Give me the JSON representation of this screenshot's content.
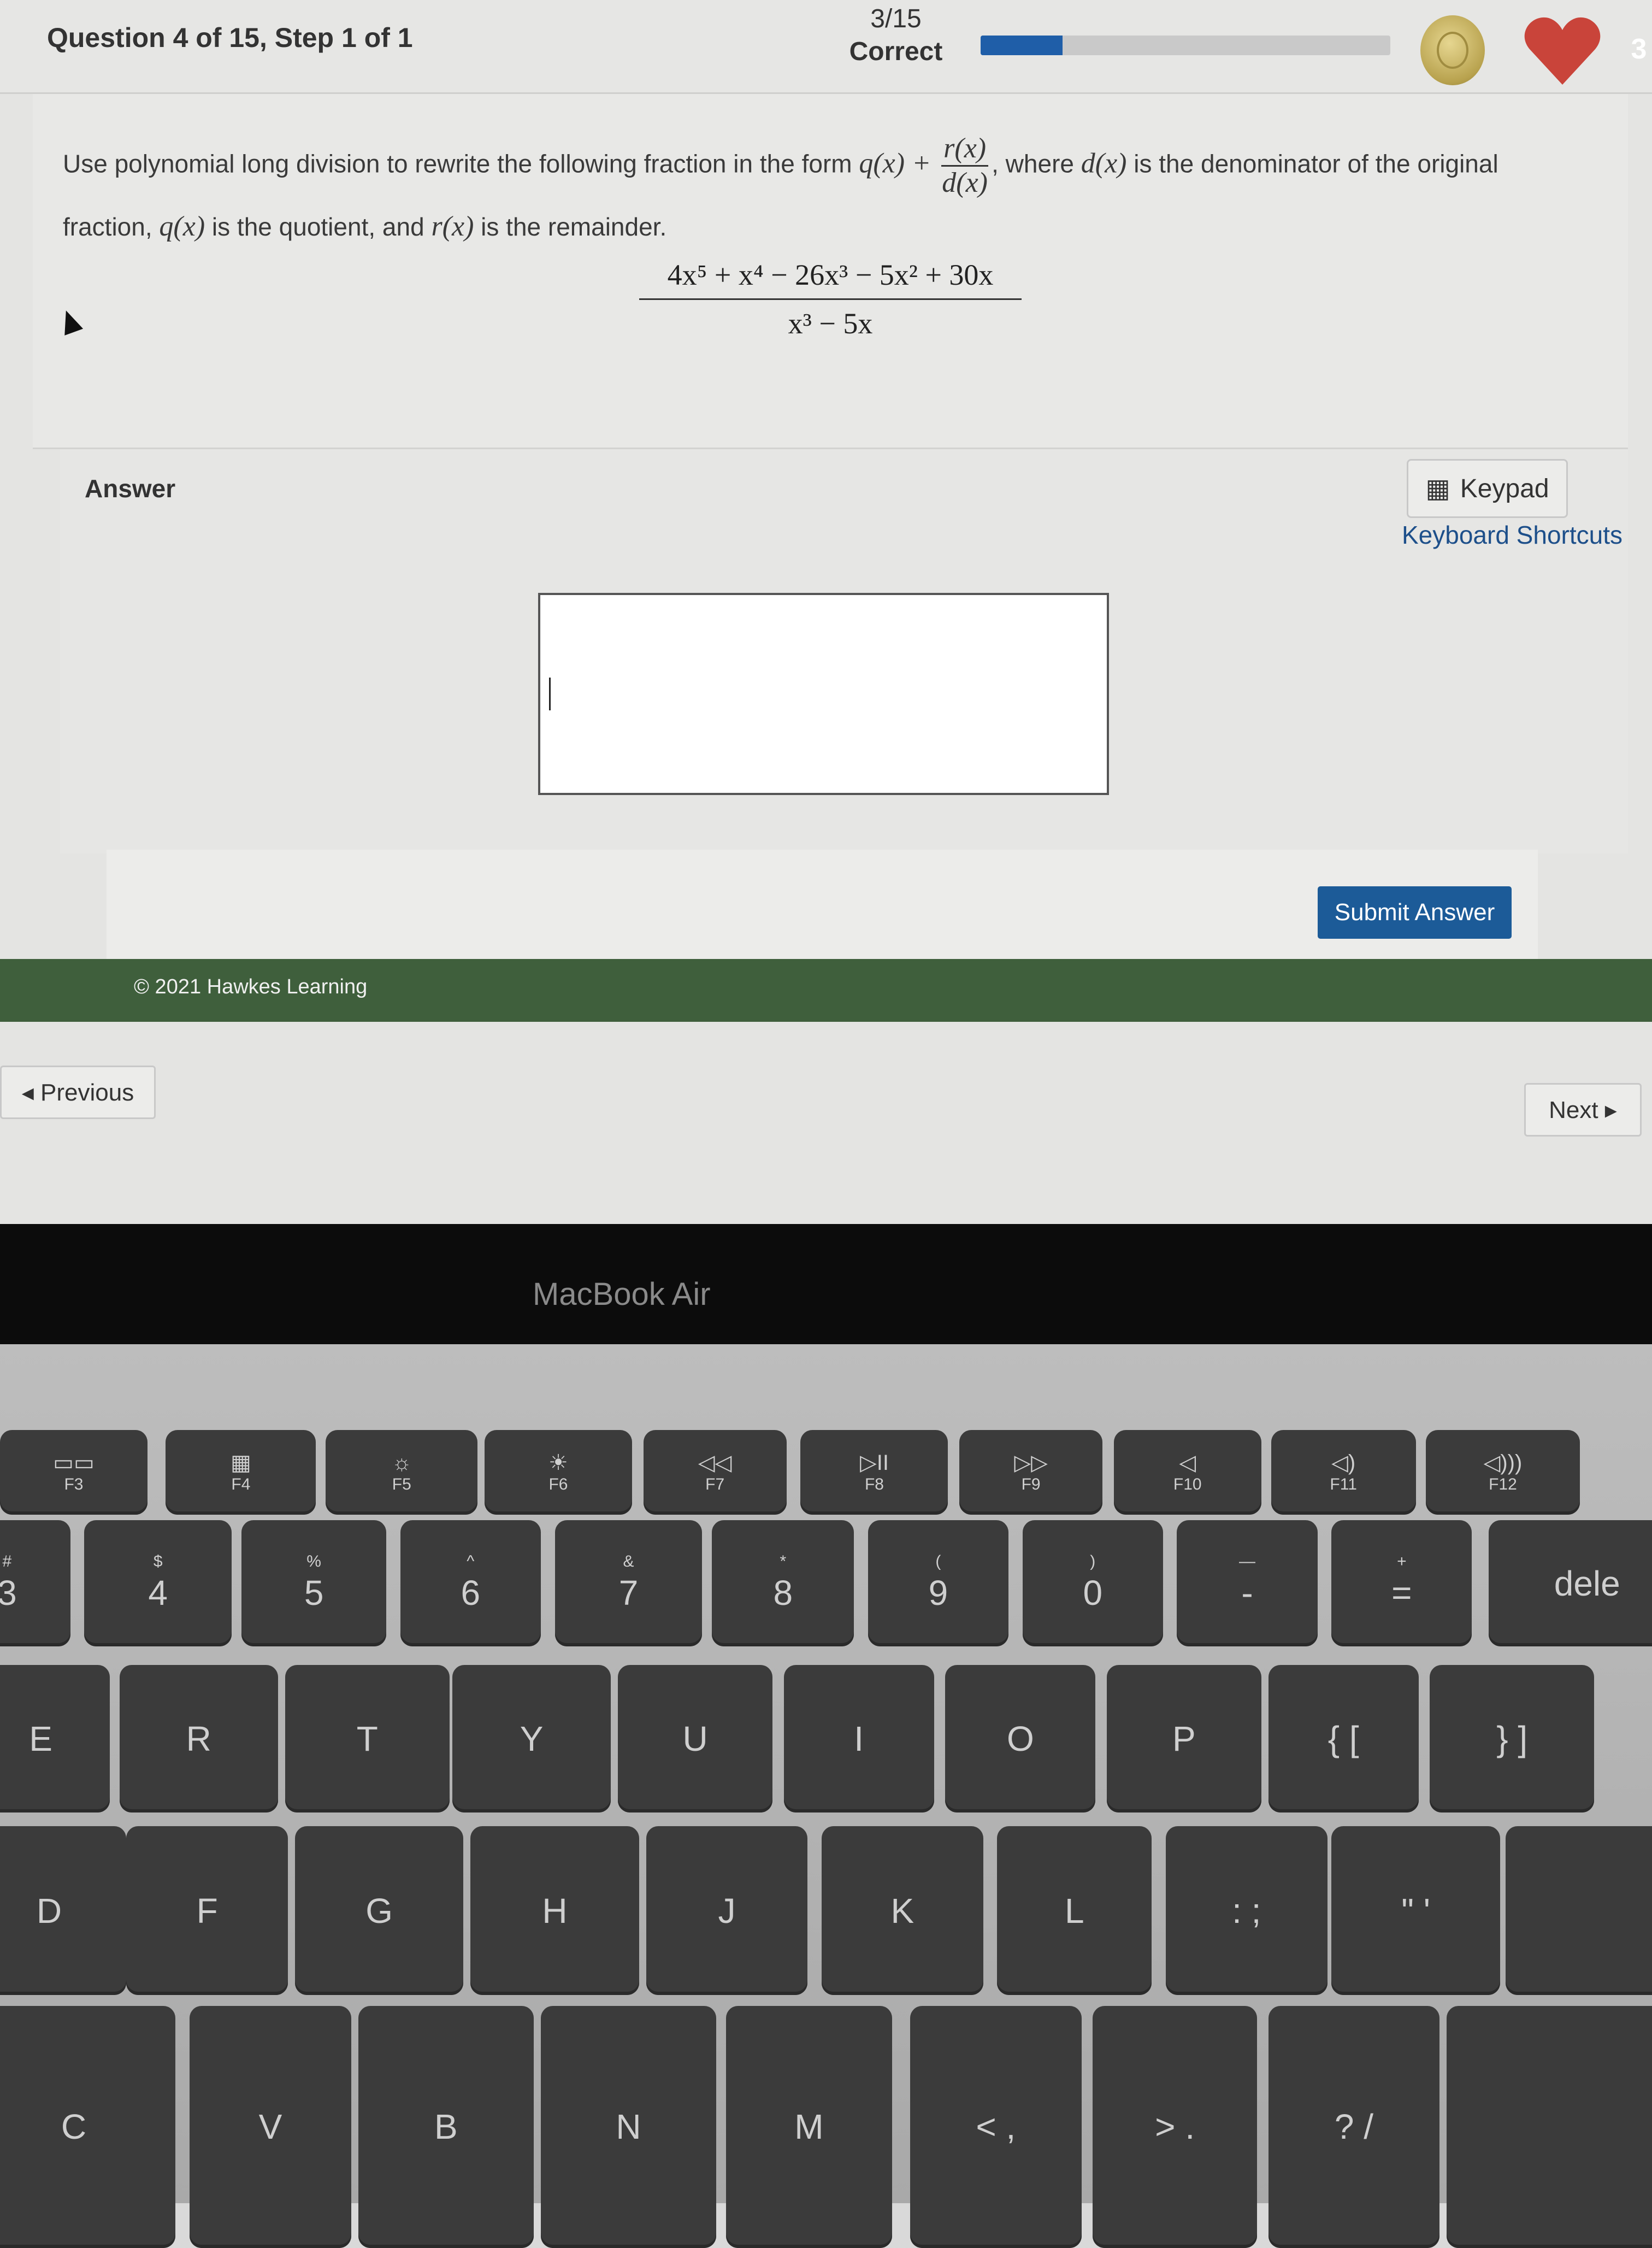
{
  "header": {
    "title": "Question 4 of 15, Step 1 of 1",
    "score": "3/15",
    "score_label": "Correct",
    "progress_fraction": 0.2,
    "lives": "3",
    "colors": {
      "progress": "#1f5ea8",
      "heart": "#c9443a",
      "footer": "#3f5f3c",
      "submit": "#1c5b98"
    }
  },
  "question": {
    "text_1": "Use polynomial long division to rewrite the following fraction in the form ",
    "form_q": "q(x) + ",
    "form_num": "r(x)",
    "form_den": "d(x)",
    "text_2": ", where ",
    "dx": "d(x)",
    "text_3": " is the denominator of the original fraction, ",
    "qx": "q(x)",
    "text_4": " is the quotient, and ",
    "rx": "r(x)",
    "text_5": " is the remainder.",
    "numerator": "4x⁵ + x⁴ − 26x³ − 5x² + 30x",
    "denominator": "x³ − 5x"
  },
  "answer": {
    "label": "Answer",
    "keypad_label": "Keypad",
    "keyboard_shortcuts": "Keyboard Shortcuts",
    "input_value": "",
    "submit": "Submit Answer"
  },
  "footer": {
    "copyright": "© 2021 Hawkes Learning"
  },
  "nav": {
    "previous": "◂ Previous",
    "next": "Next ▸"
  },
  "laptop": {
    "brand": "MacBook Air"
  },
  "keyboard": {
    "fn": [
      {
        "i": "▭▭",
        "l": "F3"
      },
      {
        "i": "▦",
        "l": "F4"
      },
      {
        "i": "☼",
        "l": "F5"
      },
      {
        "i": "☀",
        "l": "F6"
      },
      {
        "i": "◁◁",
        "l": "F7"
      },
      {
        "i": "▷II",
        "l": "F8"
      },
      {
        "i": "▷▷",
        "l": "F9"
      },
      {
        "i": "◁",
        "l": "F10"
      },
      {
        "i": "◁)",
        "l": "F11"
      },
      {
        "i": "◁)))",
        "l": "F12"
      }
    ],
    "num": [
      {
        "s": "#",
        "t": "3"
      },
      {
        "s": "$",
        "t": "4"
      },
      {
        "s": "%",
        "t": "5"
      },
      {
        "s": "^",
        "t": "6"
      },
      {
        "s": "&",
        "t": "7"
      },
      {
        "s": "*",
        "t": "8"
      },
      {
        "s": "(",
        "t": "9"
      },
      {
        "s": ")",
        "t": "0"
      },
      {
        "s": "—",
        "t": "-"
      },
      {
        "s": "+",
        "t": "="
      },
      {
        "s": "",
        "t": "dele"
      }
    ],
    "top": [
      "E",
      "R",
      "T",
      "Y",
      "U",
      "I",
      "O",
      "P",
      "{ [",
      "} ]"
    ],
    "home": [
      "D",
      "F",
      "G",
      "H",
      "J",
      "K",
      "L",
      ": ;",
      "\" '",
      ""
    ],
    "bottom": [
      "C",
      "V",
      "B",
      "N",
      "M",
      "< ,",
      "> .",
      "? /",
      ""
    ]
  }
}
